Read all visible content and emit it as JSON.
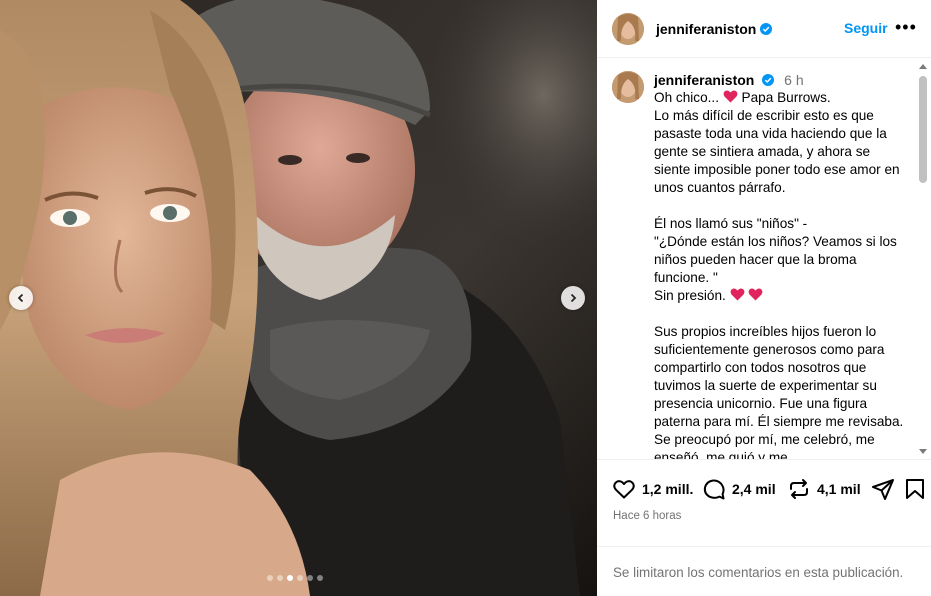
{
  "media": {
    "slides_total": 6,
    "active_slide": 3,
    "prev_icon": "chevron-left-icon",
    "next_icon": "chevron-right-icon"
  },
  "header": {
    "username": "jenniferaniston",
    "verified_icon": "verified-badge-icon",
    "follow_label": "Seguir",
    "more_label": "•••"
  },
  "caption": {
    "username": "jenniferaniston",
    "time": "6 h",
    "lines": {
      "l1": "Oh chico... ",
      "l1b": " Papa Burrows.",
      "l2": "Lo más difícil de escribir esto es que pasaste toda una vida haciendo que la gente se sintiera amada, y ahora se siente imposible poner todo ese amor en unos cuantos párrafo.",
      "l3": "Él nos llamó sus \"niños\" -\n\"¿Dónde están los niños? Veamos si los niños pueden hacer que la broma funcione. \"",
      "l4": "Sin presión. ",
      "l5": "Sus propios increíbles hijos fueron lo suficientemente generosos como para compartirlo con todos nosotros que tuvimos la suerte de experimentar su presencia unicornio. Fue una figura paterna para mí. Él siempre me revisaba. Se preocupó por mí, me celebró, me enseñó, me guió y me"
    },
    "heart_color": "#e0245e"
  },
  "actions": {
    "likes": "1,2 mill.",
    "comments": "2,4 mil",
    "reposts": "4,1 mil",
    "timestamp": "Hace 6 horas"
  },
  "footer": {
    "comments_limited": "Se limitaron los comentarios en esta publicación."
  },
  "colors": {
    "accent": "#0095f6",
    "muted": "#737373"
  }
}
